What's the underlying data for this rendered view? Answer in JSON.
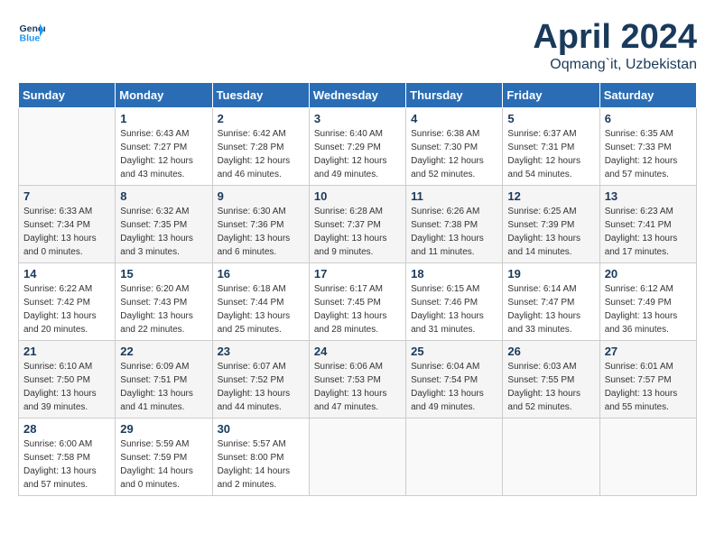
{
  "header": {
    "logo_line1": "General",
    "logo_line2": "Blue",
    "month_year": "April 2024",
    "location": "Oqmang`it, Uzbekistan"
  },
  "days_of_week": [
    "Sunday",
    "Monday",
    "Tuesday",
    "Wednesday",
    "Thursday",
    "Friday",
    "Saturday"
  ],
  "weeks": [
    [
      {
        "day": "",
        "sunrise": "",
        "sunset": "",
        "daylight": ""
      },
      {
        "day": "1",
        "sunrise": "Sunrise: 6:43 AM",
        "sunset": "Sunset: 7:27 PM",
        "daylight": "Daylight: 12 hours and 43 minutes."
      },
      {
        "day": "2",
        "sunrise": "Sunrise: 6:42 AM",
        "sunset": "Sunset: 7:28 PM",
        "daylight": "Daylight: 12 hours and 46 minutes."
      },
      {
        "day": "3",
        "sunrise": "Sunrise: 6:40 AM",
        "sunset": "Sunset: 7:29 PM",
        "daylight": "Daylight: 12 hours and 49 minutes."
      },
      {
        "day": "4",
        "sunrise": "Sunrise: 6:38 AM",
        "sunset": "Sunset: 7:30 PM",
        "daylight": "Daylight: 12 hours and 52 minutes."
      },
      {
        "day": "5",
        "sunrise": "Sunrise: 6:37 AM",
        "sunset": "Sunset: 7:31 PM",
        "daylight": "Daylight: 12 hours and 54 minutes."
      },
      {
        "day": "6",
        "sunrise": "Sunrise: 6:35 AM",
        "sunset": "Sunset: 7:33 PM",
        "daylight": "Daylight: 12 hours and 57 minutes."
      }
    ],
    [
      {
        "day": "7",
        "sunrise": "Sunrise: 6:33 AM",
        "sunset": "Sunset: 7:34 PM",
        "daylight": "Daylight: 13 hours and 0 minutes."
      },
      {
        "day": "8",
        "sunrise": "Sunrise: 6:32 AM",
        "sunset": "Sunset: 7:35 PM",
        "daylight": "Daylight: 13 hours and 3 minutes."
      },
      {
        "day": "9",
        "sunrise": "Sunrise: 6:30 AM",
        "sunset": "Sunset: 7:36 PM",
        "daylight": "Daylight: 13 hours and 6 minutes."
      },
      {
        "day": "10",
        "sunrise": "Sunrise: 6:28 AM",
        "sunset": "Sunset: 7:37 PM",
        "daylight": "Daylight: 13 hours and 9 minutes."
      },
      {
        "day": "11",
        "sunrise": "Sunrise: 6:26 AM",
        "sunset": "Sunset: 7:38 PM",
        "daylight": "Daylight: 13 hours and 11 minutes."
      },
      {
        "day": "12",
        "sunrise": "Sunrise: 6:25 AM",
        "sunset": "Sunset: 7:39 PM",
        "daylight": "Daylight: 13 hours and 14 minutes."
      },
      {
        "day": "13",
        "sunrise": "Sunrise: 6:23 AM",
        "sunset": "Sunset: 7:41 PM",
        "daylight": "Daylight: 13 hours and 17 minutes."
      }
    ],
    [
      {
        "day": "14",
        "sunrise": "Sunrise: 6:22 AM",
        "sunset": "Sunset: 7:42 PM",
        "daylight": "Daylight: 13 hours and 20 minutes."
      },
      {
        "day": "15",
        "sunrise": "Sunrise: 6:20 AM",
        "sunset": "Sunset: 7:43 PM",
        "daylight": "Daylight: 13 hours and 22 minutes."
      },
      {
        "day": "16",
        "sunrise": "Sunrise: 6:18 AM",
        "sunset": "Sunset: 7:44 PM",
        "daylight": "Daylight: 13 hours and 25 minutes."
      },
      {
        "day": "17",
        "sunrise": "Sunrise: 6:17 AM",
        "sunset": "Sunset: 7:45 PM",
        "daylight": "Daylight: 13 hours and 28 minutes."
      },
      {
        "day": "18",
        "sunrise": "Sunrise: 6:15 AM",
        "sunset": "Sunset: 7:46 PM",
        "daylight": "Daylight: 13 hours and 31 minutes."
      },
      {
        "day": "19",
        "sunrise": "Sunrise: 6:14 AM",
        "sunset": "Sunset: 7:47 PM",
        "daylight": "Daylight: 13 hours and 33 minutes."
      },
      {
        "day": "20",
        "sunrise": "Sunrise: 6:12 AM",
        "sunset": "Sunset: 7:49 PM",
        "daylight": "Daylight: 13 hours and 36 minutes."
      }
    ],
    [
      {
        "day": "21",
        "sunrise": "Sunrise: 6:10 AM",
        "sunset": "Sunset: 7:50 PM",
        "daylight": "Daylight: 13 hours and 39 minutes."
      },
      {
        "day": "22",
        "sunrise": "Sunrise: 6:09 AM",
        "sunset": "Sunset: 7:51 PM",
        "daylight": "Daylight: 13 hours and 41 minutes."
      },
      {
        "day": "23",
        "sunrise": "Sunrise: 6:07 AM",
        "sunset": "Sunset: 7:52 PM",
        "daylight": "Daylight: 13 hours and 44 minutes."
      },
      {
        "day": "24",
        "sunrise": "Sunrise: 6:06 AM",
        "sunset": "Sunset: 7:53 PM",
        "daylight": "Daylight: 13 hours and 47 minutes."
      },
      {
        "day": "25",
        "sunrise": "Sunrise: 6:04 AM",
        "sunset": "Sunset: 7:54 PM",
        "daylight": "Daylight: 13 hours and 49 minutes."
      },
      {
        "day": "26",
        "sunrise": "Sunrise: 6:03 AM",
        "sunset": "Sunset: 7:55 PM",
        "daylight": "Daylight: 13 hours and 52 minutes."
      },
      {
        "day": "27",
        "sunrise": "Sunrise: 6:01 AM",
        "sunset": "Sunset: 7:57 PM",
        "daylight": "Daylight: 13 hours and 55 minutes."
      }
    ],
    [
      {
        "day": "28",
        "sunrise": "Sunrise: 6:00 AM",
        "sunset": "Sunset: 7:58 PM",
        "daylight": "Daylight: 13 hours and 57 minutes."
      },
      {
        "day": "29",
        "sunrise": "Sunrise: 5:59 AM",
        "sunset": "Sunset: 7:59 PM",
        "daylight": "Daylight: 14 hours and 0 minutes."
      },
      {
        "day": "30",
        "sunrise": "Sunrise: 5:57 AM",
        "sunset": "Sunset: 8:00 PM",
        "daylight": "Daylight: 14 hours and 2 minutes."
      },
      {
        "day": "",
        "sunrise": "",
        "sunset": "",
        "daylight": ""
      },
      {
        "day": "",
        "sunrise": "",
        "sunset": "",
        "daylight": ""
      },
      {
        "day": "",
        "sunrise": "",
        "sunset": "",
        "daylight": ""
      },
      {
        "day": "",
        "sunrise": "",
        "sunset": "",
        "daylight": ""
      }
    ]
  ]
}
